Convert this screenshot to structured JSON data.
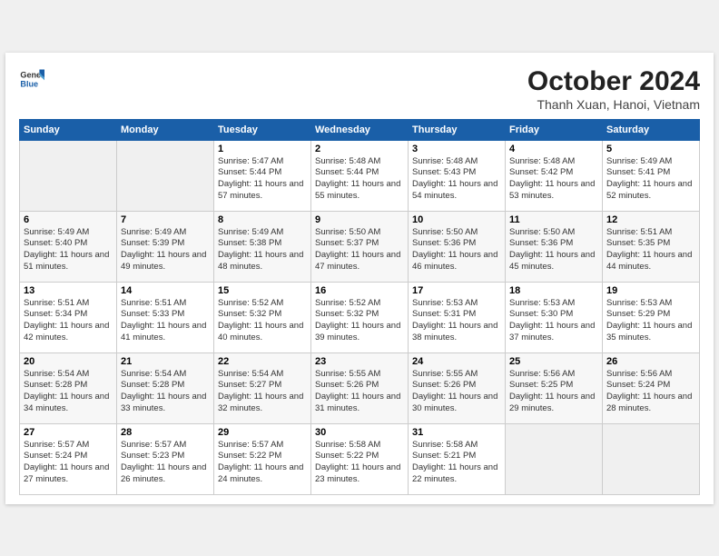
{
  "header": {
    "logo": {
      "general": "General",
      "blue": "Blue"
    },
    "title": "October 2024",
    "location": "Thanh Xuan, Hanoi, Vietnam"
  },
  "weekdays": [
    "Sunday",
    "Monday",
    "Tuesday",
    "Wednesday",
    "Thursday",
    "Friday",
    "Saturday"
  ],
  "weeks": [
    [
      {
        "day": "",
        "info": ""
      },
      {
        "day": "",
        "info": ""
      },
      {
        "day": "1",
        "info": "Sunrise: 5:47 AM\nSunset: 5:44 PM\nDaylight: 11 hours and 57 minutes."
      },
      {
        "day": "2",
        "info": "Sunrise: 5:48 AM\nSunset: 5:44 PM\nDaylight: 11 hours and 55 minutes."
      },
      {
        "day": "3",
        "info": "Sunrise: 5:48 AM\nSunset: 5:43 PM\nDaylight: 11 hours and 54 minutes."
      },
      {
        "day": "4",
        "info": "Sunrise: 5:48 AM\nSunset: 5:42 PM\nDaylight: 11 hours and 53 minutes."
      },
      {
        "day": "5",
        "info": "Sunrise: 5:49 AM\nSunset: 5:41 PM\nDaylight: 11 hours and 52 minutes."
      }
    ],
    [
      {
        "day": "6",
        "info": "Sunrise: 5:49 AM\nSunset: 5:40 PM\nDaylight: 11 hours and 51 minutes."
      },
      {
        "day": "7",
        "info": "Sunrise: 5:49 AM\nSunset: 5:39 PM\nDaylight: 11 hours and 49 minutes."
      },
      {
        "day": "8",
        "info": "Sunrise: 5:49 AM\nSunset: 5:38 PM\nDaylight: 11 hours and 48 minutes."
      },
      {
        "day": "9",
        "info": "Sunrise: 5:50 AM\nSunset: 5:37 PM\nDaylight: 11 hours and 47 minutes."
      },
      {
        "day": "10",
        "info": "Sunrise: 5:50 AM\nSunset: 5:36 PM\nDaylight: 11 hours and 46 minutes."
      },
      {
        "day": "11",
        "info": "Sunrise: 5:50 AM\nSunset: 5:36 PM\nDaylight: 11 hours and 45 minutes."
      },
      {
        "day": "12",
        "info": "Sunrise: 5:51 AM\nSunset: 5:35 PM\nDaylight: 11 hours and 44 minutes."
      }
    ],
    [
      {
        "day": "13",
        "info": "Sunrise: 5:51 AM\nSunset: 5:34 PM\nDaylight: 11 hours and 42 minutes."
      },
      {
        "day": "14",
        "info": "Sunrise: 5:51 AM\nSunset: 5:33 PM\nDaylight: 11 hours and 41 minutes."
      },
      {
        "day": "15",
        "info": "Sunrise: 5:52 AM\nSunset: 5:32 PM\nDaylight: 11 hours and 40 minutes."
      },
      {
        "day": "16",
        "info": "Sunrise: 5:52 AM\nSunset: 5:32 PM\nDaylight: 11 hours and 39 minutes."
      },
      {
        "day": "17",
        "info": "Sunrise: 5:53 AM\nSunset: 5:31 PM\nDaylight: 11 hours and 38 minutes."
      },
      {
        "day": "18",
        "info": "Sunrise: 5:53 AM\nSunset: 5:30 PM\nDaylight: 11 hours and 37 minutes."
      },
      {
        "day": "19",
        "info": "Sunrise: 5:53 AM\nSunset: 5:29 PM\nDaylight: 11 hours and 35 minutes."
      }
    ],
    [
      {
        "day": "20",
        "info": "Sunrise: 5:54 AM\nSunset: 5:28 PM\nDaylight: 11 hours and 34 minutes."
      },
      {
        "day": "21",
        "info": "Sunrise: 5:54 AM\nSunset: 5:28 PM\nDaylight: 11 hours and 33 minutes."
      },
      {
        "day": "22",
        "info": "Sunrise: 5:54 AM\nSunset: 5:27 PM\nDaylight: 11 hours and 32 minutes."
      },
      {
        "day": "23",
        "info": "Sunrise: 5:55 AM\nSunset: 5:26 PM\nDaylight: 11 hours and 31 minutes."
      },
      {
        "day": "24",
        "info": "Sunrise: 5:55 AM\nSunset: 5:26 PM\nDaylight: 11 hours and 30 minutes."
      },
      {
        "day": "25",
        "info": "Sunrise: 5:56 AM\nSunset: 5:25 PM\nDaylight: 11 hours and 29 minutes."
      },
      {
        "day": "26",
        "info": "Sunrise: 5:56 AM\nSunset: 5:24 PM\nDaylight: 11 hours and 28 minutes."
      }
    ],
    [
      {
        "day": "27",
        "info": "Sunrise: 5:57 AM\nSunset: 5:24 PM\nDaylight: 11 hours and 27 minutes."
      },
      {
        "day": "28",
        "info": "Sunrise: 5:57 AM\nSunset: 5:23 PM\nDaylight: 11 hours and 26 minutes."
      },
      {
        "day": "29",
        "info": "Sunrise: 5:57 AM\nSunset: 5:22 PM\nDaylight: 11 hours and 24 minutes."
      },
      {
        "day": "30",
        "info": "Sunrise: 5:58 AM\nSunset: 5:22 PM\nDaylight: 11 hours and 23 minutes."
      },
      {
        "day": "31",
        "info": "Sunrise: 5:58 AM\nSunset: 5:21 PM\nDaylight: 11 hours and 22 minutes."
      },
      {
        "day": "",
        "info": ""
      },
      {
        "day": "",
        "info": ""
      }
    ]
  ]
}
